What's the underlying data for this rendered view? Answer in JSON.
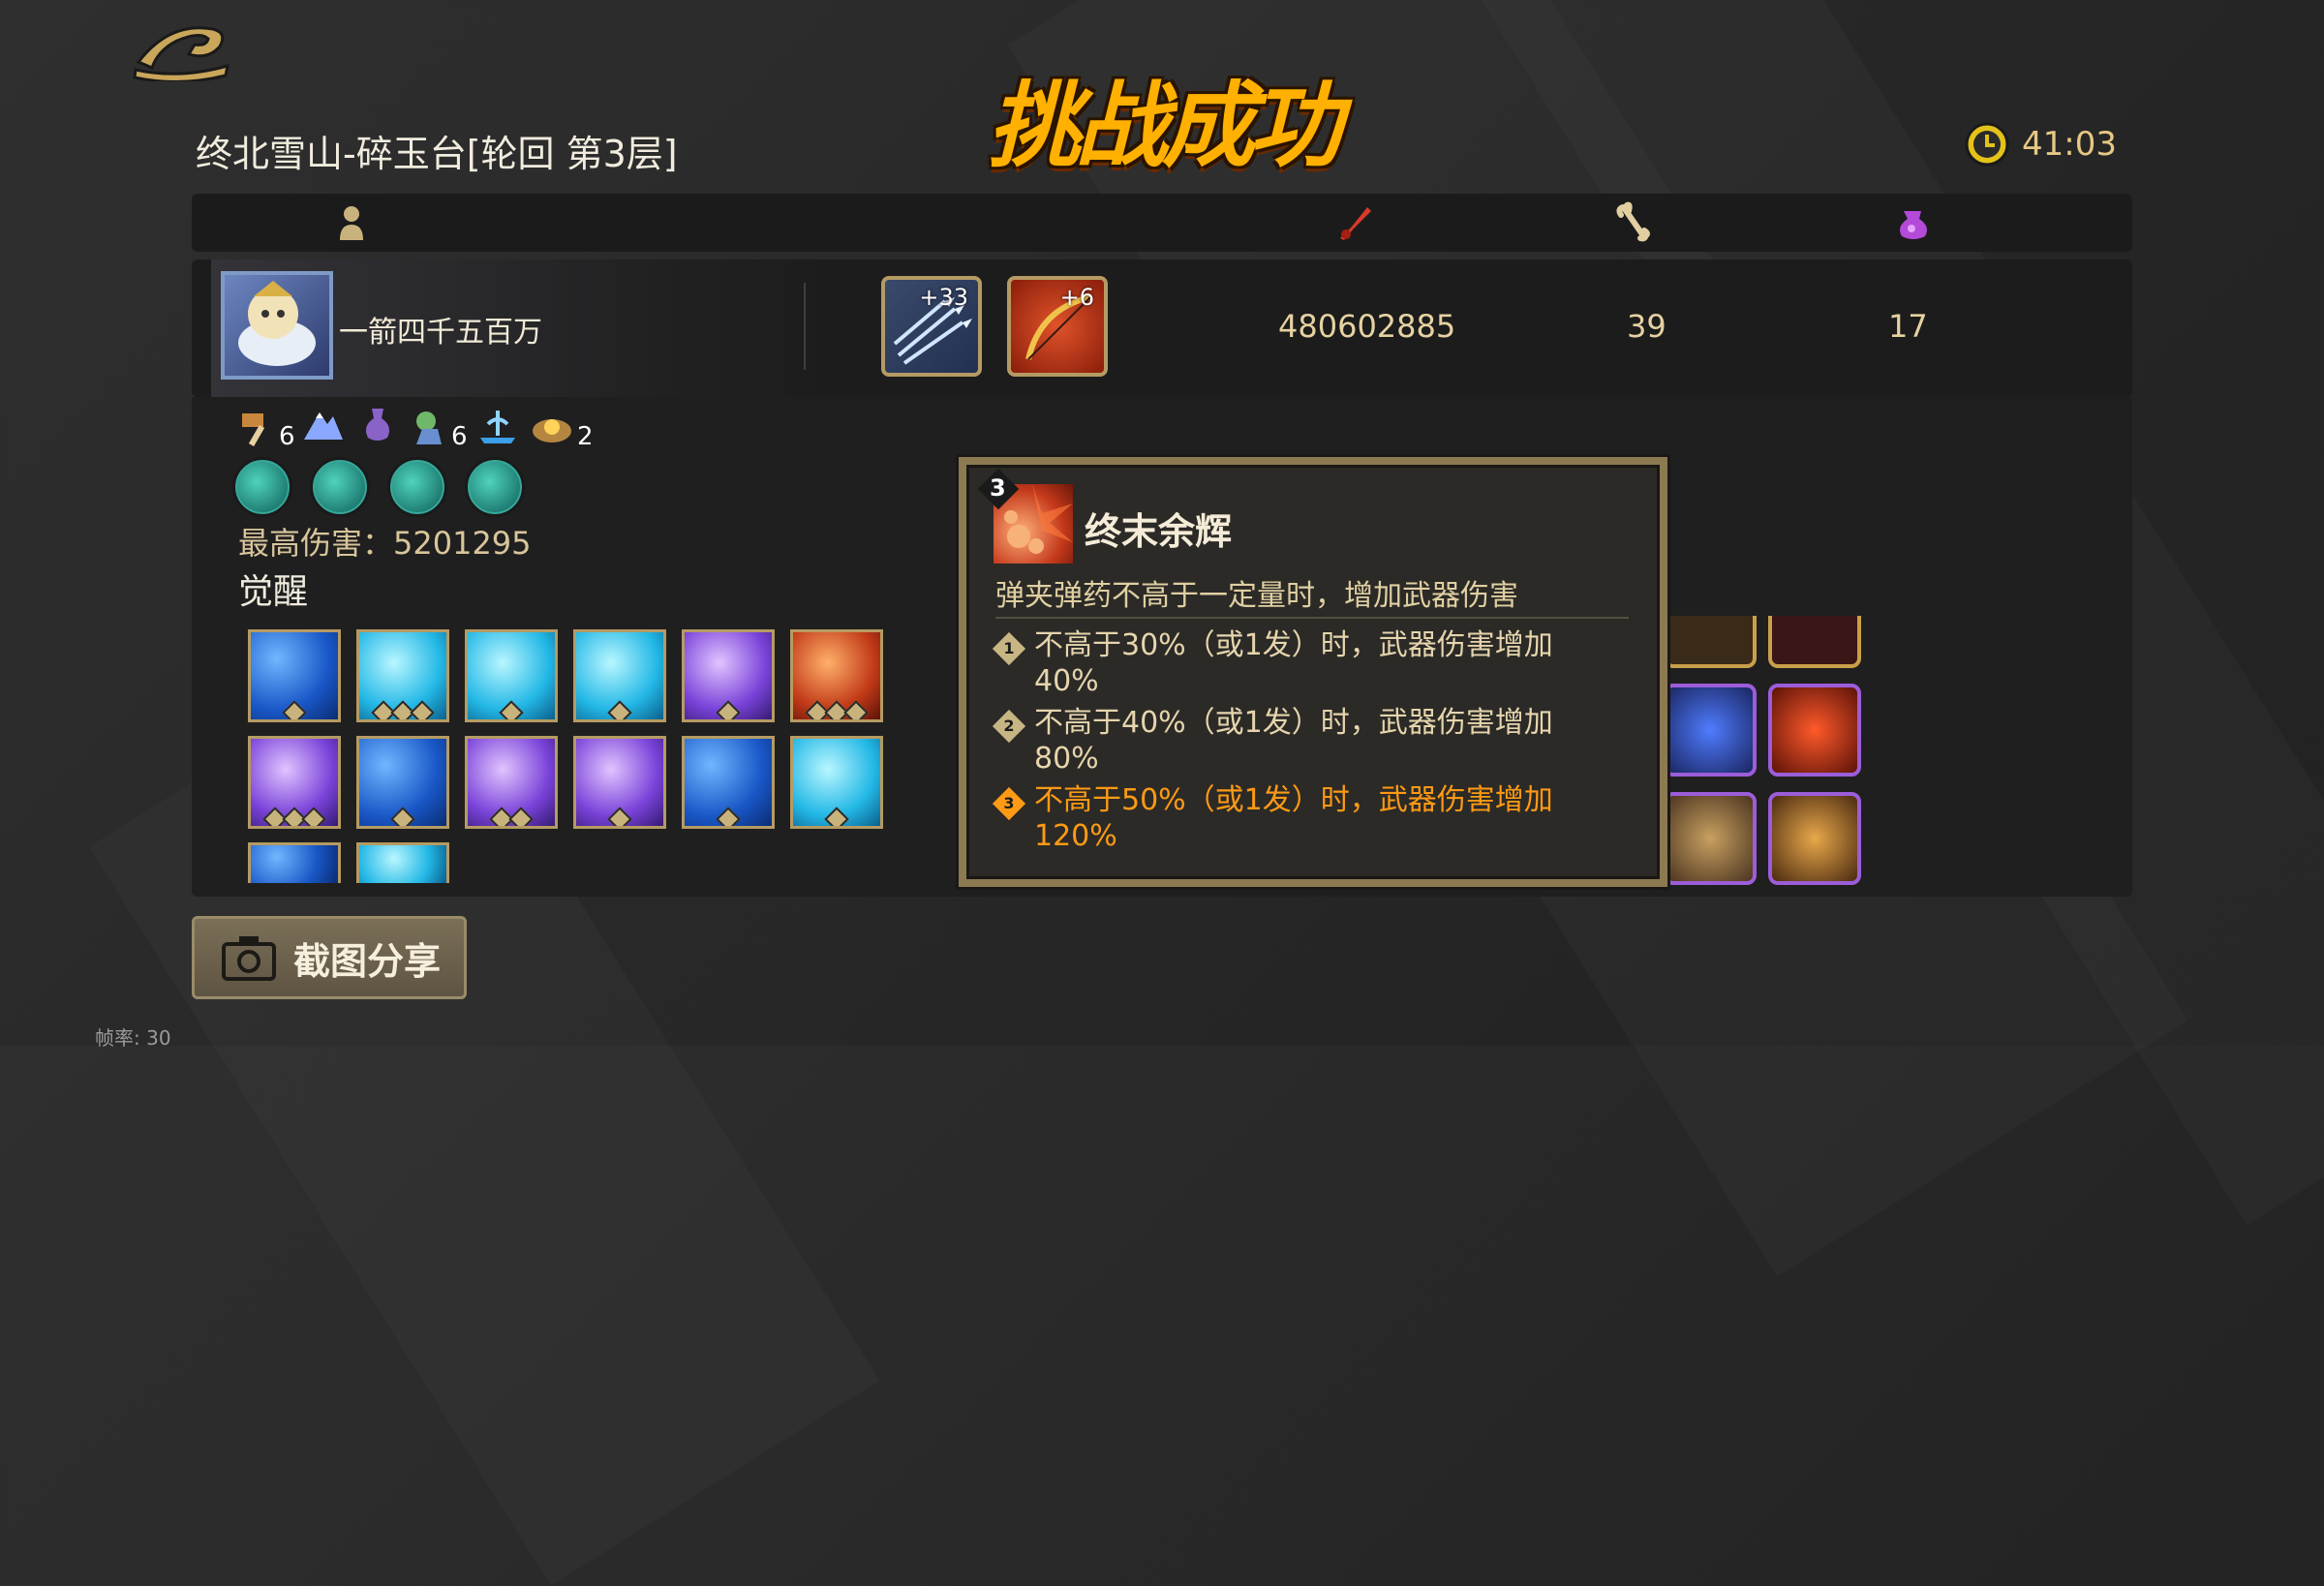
{
  "header": {
    "title": "挑战成功",
    "stage": "终北雪山-碎玉台[轮回  第3层]",
    "timer": "41:03"
  },
  "player": {
    "name": "一箭四千五百万",
    "weapons": [
      {
        "level": "+33",
        "icon": "arrows-icon"
      },
      {
        "level": "+6",
        "icon": "bow-icon"
      }
    ],
    "damage": "480602885",
    "stat2": "39",
    "stat3": "17"
  },
  "traits": [
    {
      "icon": "hammer-icon",
      "count": "6"
    },
    {
      "icon": "mountain-icon",
      "count": ""
    },
    {
      "icon": "flask-icon",
      "count": ""
    },
    {
      "icon": "creature-icon",
      "count": "6"
    },
    {
      "icon": "fountain-icon",
      "count": ""
    },
    {
      "icon": "coin-pile-icon",
      "count": "2"
    }
  ],
  "max_damage": "最高伤害：5201295",
  "awaken_label": "觉醒",
  "tooltip": {
    "level": "3",
    "title": "终末余辉",
    "description": "弹夹弹药不高于一定量时，增加武器伤害",
    "tiers": [
      {
        "marker": "1",
        "text": "不高于30%（或1发）时，武器伤害增加40%",
        "color": "#e6d5ad"
      },
      {
        "marker": "2",
        "text": "不高于40%（或1发）时，武器伤害增加80%",
        "color": "#e6d5ad"
      },
      {
        "marker": "3",
        "text": "不高于50%（或1发）时，武器伤害增加120%",
        "color": "#ff9a14"
      }
    ]
  },
  "share_button": "截图分享",
  "fps": "帧率: 30",
  "colors": {
    "accent": "#ffb000",
    "highlight": "#ff9a14",
    "gold": "#b59b63"
  }
}
